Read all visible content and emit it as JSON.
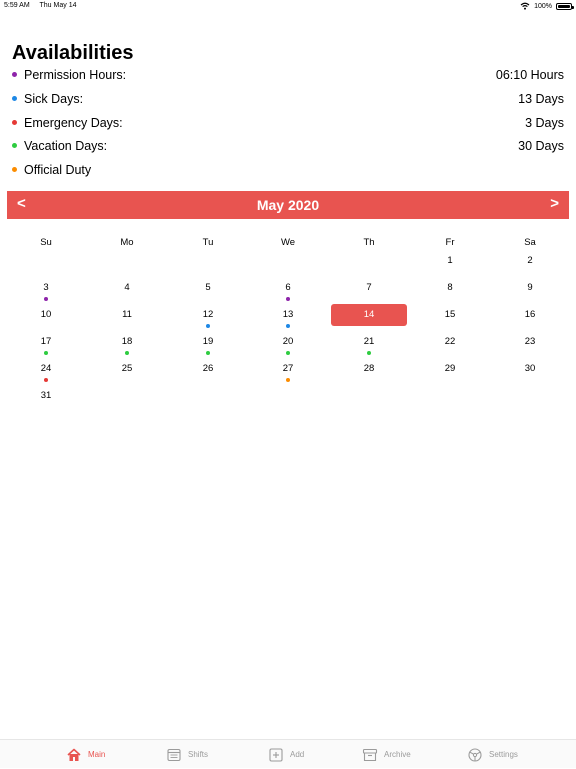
{
  "status": {
    "time": "5:59 AM",
    "date": "Thu May 14",
    "battery": "100%"
  },
  "title": "Availabilities",
  "availabilities": [
    {
      "label": "Permission Hours:",
      "value": "06:10 Hours",
      "color": "#8e24aa"
    },
    {
      "label": "Sick Days:",
      "value": "13 Days",
      "color": "#1e88e5"
    },
    {
      "label": "Emergency Days:",
      "value": "3 Days",
      "color": "#e53935"
    },
    {
      "label": "Vacation Days:",
      "value": "30 Days",
      "color": "#2ecc40"
    },
    {
      "label": "Official Duty",
      "value": "",
      "color": "#fb8c00"
    }
  ],
  "calendar": {
    "month_title": "May 2020",
    "prev": "<",
    "next": ">",
    "accent": "#e85450",
    "weekdays": [
      "Su",
      "Mo",
      "Tu",
      "We",
      "Th",
      "Fr",
      "Sa"
    ],
    "first_weekday_index": 5,
    "days_in_month": 31,
    "selected_day": 14,
    "markers": {
      "3": "#8e24aa",
      "6": "#8e24aa",
      "12": "#1e88e5",
      "13": "#1e88e5",
      "17": "#2ecc40",
      "18": "#2ecc40",
      "19": "#2ecc40",
      "20": "#2ecc40",
      "21": "#2ecc40",
      "24": "#e53935",
      "27": "#fb8c00"
    }
  },
  "tabs": [
    {
      "label": "Main",
      "icon": "home-icon",
      "active": true
    },
    {
      "label": "Shifts",
      "icon": "shifts-icon",
      "active": false
    },
    {
      "label": "Add",
      "icon": "add-icon",
      "active": false
    },
    {
      "label": "Archive",
      "icon": "archive-icon",
      "active": false
    },
    {
      "label": "Settings",
      "icon": "settings-icon",
      "active": false
    }
  ]
}
